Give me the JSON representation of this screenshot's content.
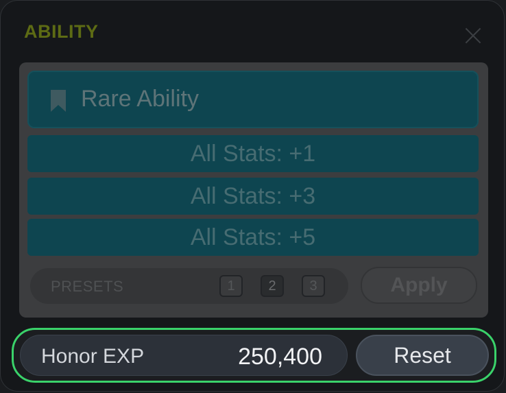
{
  "window": {
    "title": "ABILITY",
    "close_icon": "close-icon"
  },
  "ability": {
    "grade_icon": "bookmark-icon",
    "grade_label": "Rare Ability",
    "stats": [
      "All Stats: +1",
      "All Stats: +3",
      "All Stats: +5"
    ]
  },
  "presets": {
    "label": "PRESETS",
    "buttons": [
      "1",
      "2",
      "3"
    ],
    "active": "2",
    "apply_label": "Apply"
  },
  "honor": {
    "label": "Honor EXP",
    "value": "250,400",
    "reset_label": "Reset"
  },
  "colors": {
    "title": "#5d6b14",
    "stat_row": "#0e4550",
    "highlight_border": "#3ad26a"
  }
}
